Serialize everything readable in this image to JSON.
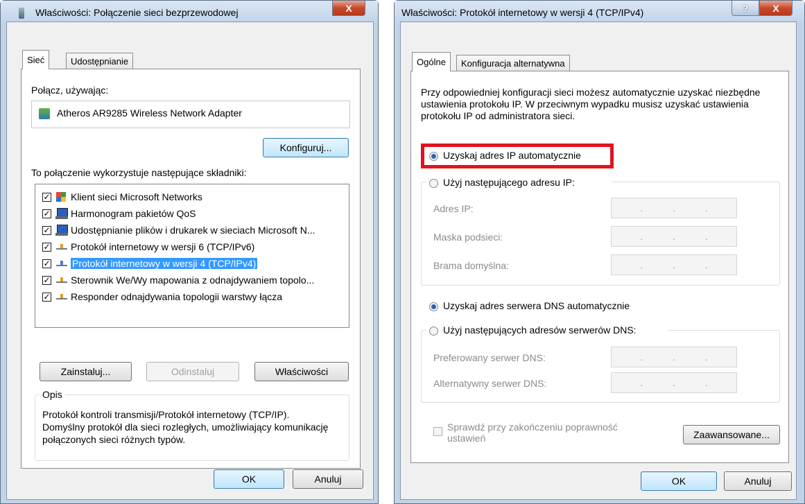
{
  "left_dialog": {
    "title": "Właściwości: Połączenie sieci bezprzewodowej",
    "close_label": "X",
    "tabs": [
      "Sieć",
      "Udostępnianie"
    ],
    "connect_using_label": "Połącz, używając:",
    "adapter_name": "Atheros AR9285 Wireless Network Adapter",
    "configure_label": "Konfiguruj...",
    "components_label": "To połączenie wykorzystuje następujące składniki:",
    "components": [
      {
        "label": "Klient sieci Microsoft Networks",
        "icon": "network-client-icon",
        "checked": true,
        "selected": false
      },
      {
        "label": "Harmonogram pakietów QoS",
        "icon": "computer-icon",
        "checked": true,
        "selected": false
      },
      {
        "label": "Udostępnianie plików i drukarek w sieciach Microsoft N...",
        "icon": "computer-icon",
        "checked": true,
        "selected": false
      },
      {
        "label": "Protokół internetowy w wersji 6 (TCP/IPv6)",
        "icon": "protocol-icon",
        "checked": true,
        "selected": false
      },
      {
        "label": "Protokół internetowy w wersji 4 (TCP/IPv4)",
        "icon": "protocol-icon",
        "checked": true,
        "selected": true
      },
      {
        "label": "Sterownik We/Wy mapowania z odnajdywaniem topolo...",
        "icon": "protocol-icon",
        "checked": true,
        "selected": false
      },
      {
        "label": "Responder odnajdywania topologii warstwy łącza",
        "icon": "protocol-icon",
        "checked": true,
        "selected": false
      }
    ],
    "install_label": "Zainstaluj...",
    "uninstall_label": "Odinstaluj",
    "properties_label": "Właściwości",
    "description_group": "Opis",
    "description_text": "Protokół kontroli transmisji/Protokół internetowy (TCP/IP). Domyślny protokół dla sieci rozległych, umożliwiający komunikację połączonych sieci różnych typów.",
    "ok_label": "OK",
    "cancel_label": "Anuluj"
  },
  "right_dialog": {
    "title": "Właściwości: Protokół internetowy w wersji 4 (TCP/IPv4)",
    "help_label": "?",
    "close_label": "X",
    "tabs": [
      "Ogólne",
      "Konfiguracja alternatywna"
    ],
    "intro_text": "Przy odpowiedniej konfiguracji sieci możesz automatycznie uzyskać niezbędne ustawienia protokołu IP. W przeciwnym wypadku musisz uzyskać ustawienia protokołu IP od administratora sieci.",
    "auto_ip_label": "Uzyskaj adres IP automatycznie",
    "manual_ip_label": "Użyj następującego adresu IP:",
    "ip_fields": [
      "Adres IP:",
      "Maska podsieci:",
      "Brama domyślna:"
    ],
    "ip_dots": ".   .   .",
    "auto_dns_label": "Uzyskaj adres serwera DNS automatycznie",
    "manual_dns_label": "Użyj następujących adresów serwerów DNS:",
    "dns_fields": [
      "Preferowany serwer DNS:",
      "Alternatywny serwer DNS:"
    ],
    "validate_label": "Sprawdź przy zakończeniu poprawność ustawień",
    "advanced_label": "Zaawansowane...",
    "ok_label": "OK",
    "cancel_label": "Anuluj",
    "highlight_color": "#e0141e"
  }
}
